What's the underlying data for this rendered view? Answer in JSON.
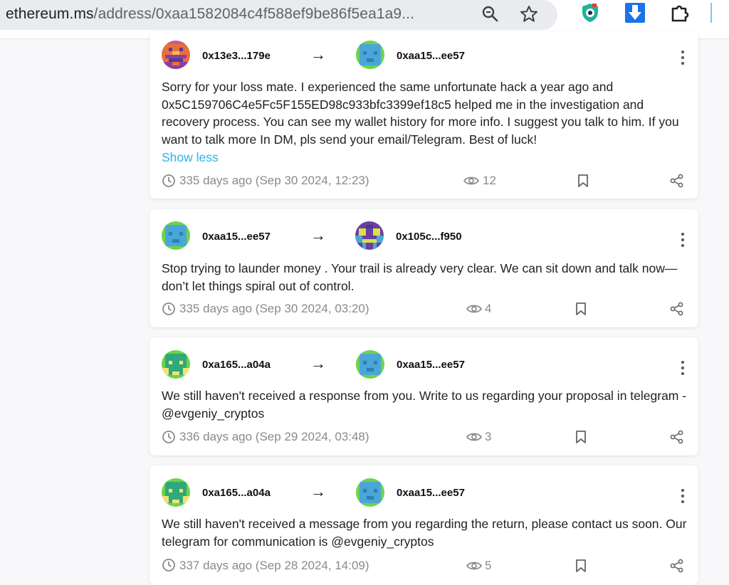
{
  "browser": {
    "url_host": "ethereum.ms",
    "url_path": "/address/0xaa1582084c4f588ef9be86f5ea1a9..."
  },
  "feed": [
    {
      "from": "0x13e3...179e",
      "to": "0xaa15...ee57",
      "message": "Sorry for your loss mate. I experienced the same unfortunate hack a year ago and 0x5C159706C4e5Fc5F155ED98c933bfc3399ef18c5 helped me in the investigation and recovery process. You can see my wallet history for more info. I suggest you talk to him. If you want to talk more In DM, pls send your email/Telegram. Best of luck!",
      "toggle": "Show less",
      "time": "335 days ago (Sep 30 2024, 12:23)",
      "views": "12"
    },
    {
      "from": "0xaa15...ee57",
      "to": "0x105c...f950",
      "message": "Stop trying to launder money . Your trail is already very clear. We can sit down and talk now—don’t let things spiral out of control.",
      "time": "335 days ago (Sep 30 2024, 03:20)",
      "views": "4"
    },
    {
      "from": "0xa165...a04a",
      "to": "0xaa15...ee57",
      "message": "We still haven't received a response from you. Write to us regarding your proposal in telegram - @evgeniy_cryptos",
      "time": "336 days ago (Sep 29 2024, 03:48)",
      "views": "3"
    },
    {
      "from": "0xa165...a04a",
      "to": "0xaa15...ee57",
      "message": "We still haven't received a message from you regarding the return, please contact us soon. Our telegram for communication is @evgeniy_cryptos",
      "time": "337 days ago (Sep 28 2024, 14:09)",
      "views": "5"
    }
  ],
  "icons": {
    "arrow": "→",
    "clock": "clock-icon",
    "views": "eye-icon",
    "bookmark": "bookmark-icon",
    "share": "share-icon",
    "menu": "kebab-menu-icon"
  },
  "colors": {
    "link": "#27b7e9",
    "meta_text": "#8a8a8a",
    "page_bg": "#f8f8fa"
  }
}
